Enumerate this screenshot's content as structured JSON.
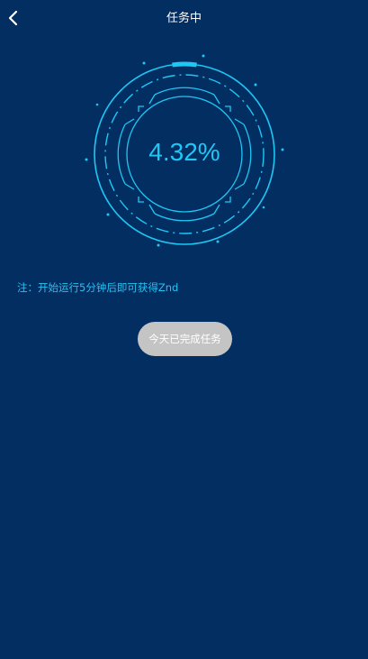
{
  "header": {
    "title": "任务中",
    "back_icon": "chevron-left-icon"
  },
  "progress": {
    "label": "4.32%",
    "value_percent": 4.32,
    "ring_color": "#1ec8f5"
  },
  "note": {
    "text": "注：开始运行5分钟后即可获得Znd"
  },
  "status_button": {
    "label": "今天已完成任务"
  },
  "colors": {
    "background": "#032e61",
    "accent": "#1ec8f5",
    "button_disabled": "#c4c4c4"
  }
}
